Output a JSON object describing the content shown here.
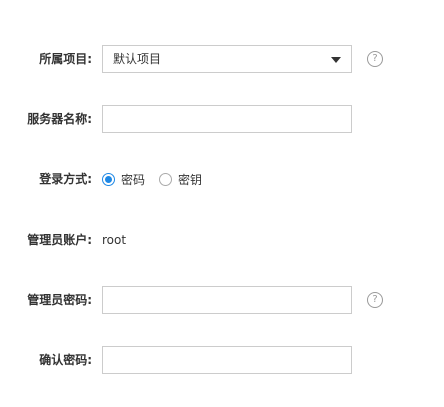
{
  "form": {
    "project": {
      "label": "所属项目:",
      "value": "默认项目",
      "help_icon": "question-icon"
    },
    "server_name": {
      "label": "服务器名称:",
      "value": ""
    },
    "login_method": {
      "label": "登录方式:",
      "options": [
        {
          "label": "密码",
          "selected": true
        },
        {
          "label": "密钥",
          "selected": false
        }
      ]
    },
    "admin_account": {
      "label": "管理员账户:",
      "value": "root"
    },
    "admin_password": {
      "label": "管理员密码:",
      "value": "",
      "help_icon": "question-icon"
    },
    "confirm_password": {
      "label": "确认密码:",
      "value": ""
    }
  },
  "colors": {
    "accent": "#1e88e5",
    "border": "#cccccc",
    "text": "#333333",
    "help": "#9a9a9a"
  }
}
